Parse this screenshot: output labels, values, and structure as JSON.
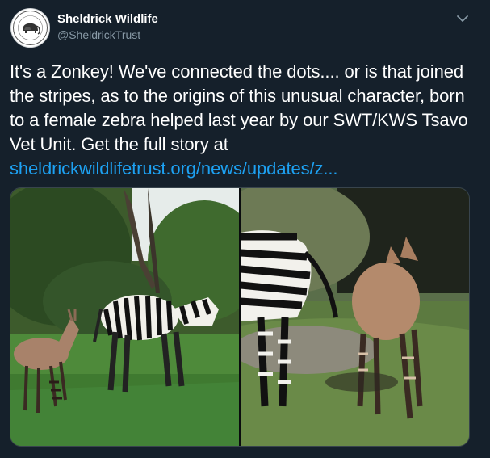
{
  "account": {
    "display_name": "Sheldrick Wildlife",
    "handle": "@SheldrickTrust",
    "avatar_icon": "sheldrick-elephant-logo"
  },
  "menu": {
    "icon": "chevron-down-icon"
  },
  "tweet": {
    "text": "It's a Zonkey! We've connected the dots.... or is that joined the stripes, as to the origins of this unusual character, born to a female zebra helped last year by our SWT/KWS Tsavo Vet Unit. Get the full story at ",
    "link_text": "sheldrickwildlifetrust.org/news/updates/z..."
  },
  "media": {
    "images": [
      "zonkey-and-zebra-in-field-photo",
      "zonkey-and-zebra-closeup-photo"
    ]
  },
  "colors": {
    "background": "#15202b",
    "text": "#ffffff",
    "secondary_text": "#8899a6",
    "link": "#1da1f2"
  }
}
